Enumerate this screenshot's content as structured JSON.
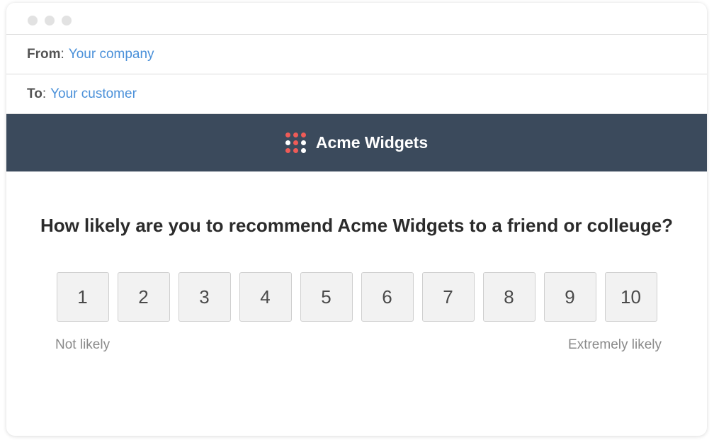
{
  "email": {
    "from_label": "From",
    "from_value": "Your company",
    "to_label": "To",
    "to_value": "Your customer",
    "separator": ":"
  },
  "brand": {
    "name": "Acme Widgets",
    "logo_icon": "dot-grid-logo-icon",
    "bar_color": "#3b4a5c",
    "accent_color": "#ef5b57"
  },
  "survey": {
    "question": "How likely are you to recommend Acme Widgets to a friend or colleuge?",
    "scores": [
      "1",
      "2",
      "3",
      "4",
      "5",
      "6",
      "7",
      "8",
      "9",
      "10"
    ],
    "low_label": "Not likely",
    "high_label": "Extremely likely"
  },
  "colors": {
    "link": "#4a90d9"
  }
}
